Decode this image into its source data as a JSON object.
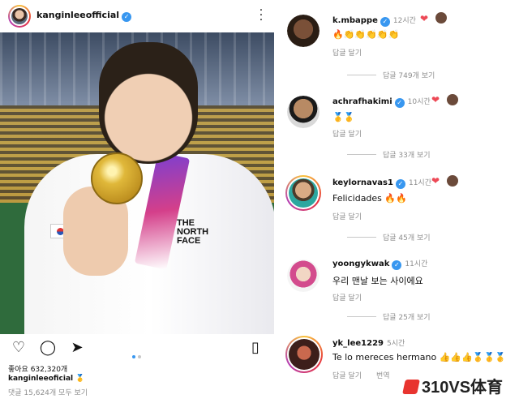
{
  "post": {
    "username": "kanginleeofficial",
    "likes": "좋아요 632,320개",
    "caption_user": "kanginleeoficial",
    "caption_emoji": "🥇",
    "view_all_comments": "댓글 15,624개 모두 보기",
    "photo_logo": [
      "THE",
      "NORTH",
      "FACE"
    ]
  },
  "comments": [
    {
      "user": "k.mbappe",
      "time": "12시간",
      "text": "🔥👏👏👏👏👏",
      "reply": "답글 달기",
      "more": "",
      "heart": true
    },
    {
      "user": "achrafhakimi",
      "time": "10시간",
      "text": "🥇🥇",
      "reply": "답글 달기",
      "more": "답글 33개 보기",
      "heart": true
    },
    {
      "user": "keylornavas1",
      "time": "11시간",
      "text": "Felicidades 🔥🔥",
      "reply": "답글 달기",
      "more": "답글 45개 보기",
      "heart": true
    },
    {
      "user": "yoongykwak",
      "time": "11시간",
      "text": "우리 맨날 보는 사이에요",
      "reply": "답글 달기",
      "more": "답글 25개 보기",
      "heart": false
    },
    {
      "user": "yk_lee1229",
      "time": "5시간",
      "text": "Te lo mereces hermano 👍👍👍🥇🥇🥇",
      "reply": "답글 달기",
      "translate": "번역",
      "more": "",
      "heart": false
    }
  ],
  "comment0_more": "답글 749개 보기",
  "watermark": "310VS体育"
}
